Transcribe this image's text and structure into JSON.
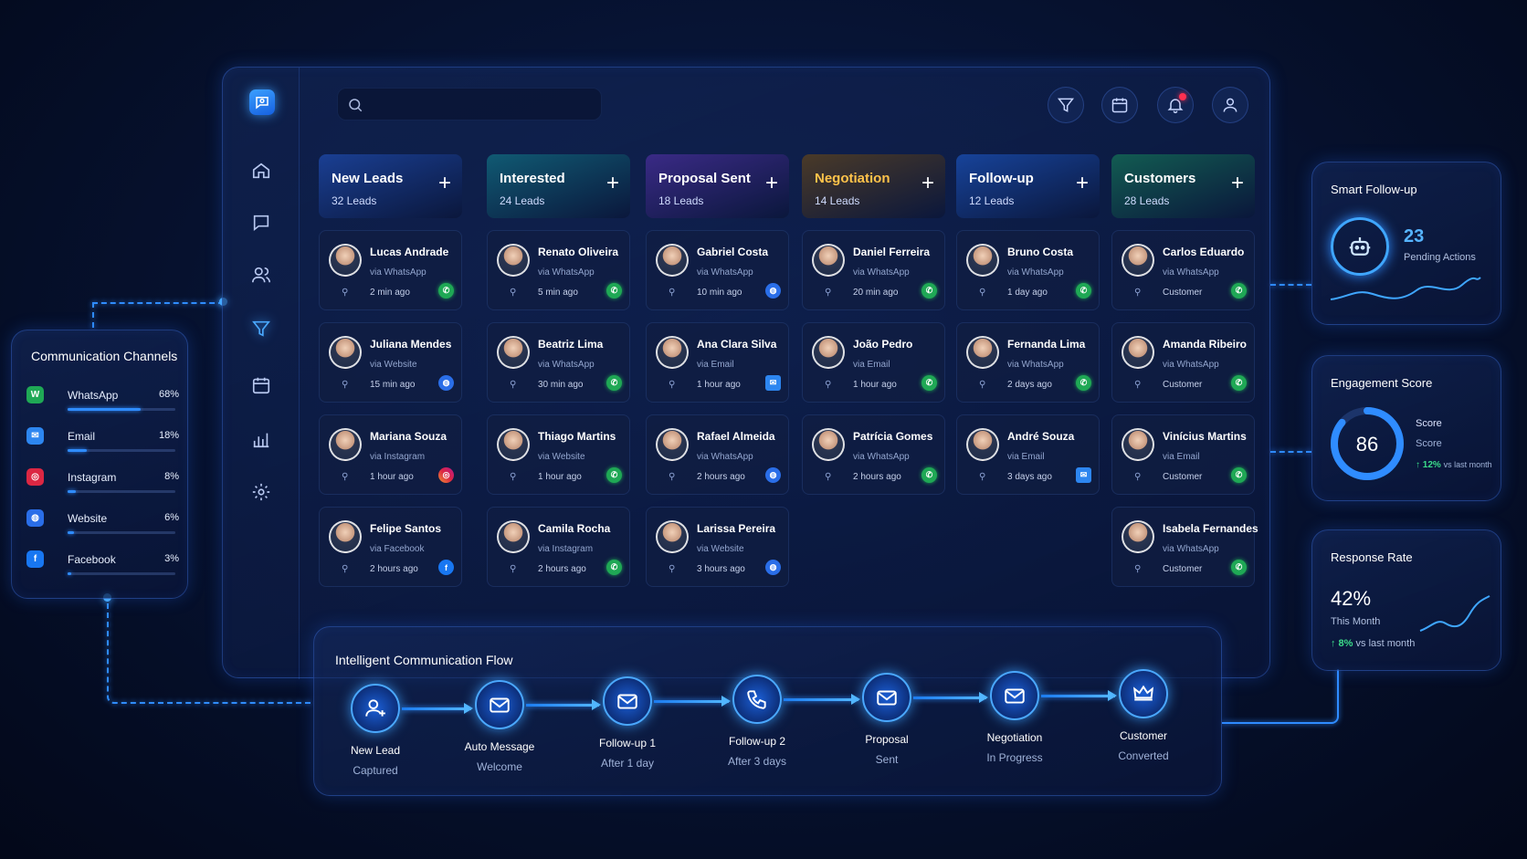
{
  "search": {
    "placeholder": ""
  },
  "columns": [
    {
      "title": "New Leads",
      "count": "32 Leads",
      "color": "#1a3f93",
      "cards": [
        {
          "name": "Lucas Andrade",
          "via": "via WhatsApp",
          "time": "2 min ago",
          "channel": "wa"
        },
        {
          "name": "Juliana Mendes",
          "via": "via Website",
          "time": "15 min ago",
          "channel": "web"
        },
        {
          "name": "Mariana Souza",
          "via": "via Instagram",
          "time": "1 hour ago",
          "channel": "ig"
        },
        {
          "name": "Felipe Santos",
          "via": "via Facebook",
          "time": "2 hours ago",
          "channel": "fb"
        }
      ]
    },
    {
      "title": "Interested",
      "count": "24 Leads",
      "color": "#105a73",
      "cards": [
        {
          "name": "Renato Oliveira",
          "via": "via WhatsApp",
          "time": "5 min ago",
          "channel": "wa"
        },
        {
          "name": "Beatriz Lima",
          "via": "via WhatsApp",
          "time": "30 min ago",
          "channel": "wa"
        },
        {
          "name": "Thiago Martins",
          "via": "via Website",
          "time": "1 hour ago",
          "channel": "wa"
        },
        {
          "name": "Camila Rocha",
          "via": "via Instagram",
          "time": "2 hours ago",
          "channel": "wa"
        }
      ]
    },
    {
      "title": "Proposal Sent",
      "count": "18 Leads",
      "color": "#3a2a86",
      "cards": [
        {
          "name": "Gabriel Costa",
          "via": "via WhatsApp",
          "time": "10 min ago",
          "channel": "web"
        },
        {
          "name": "Ana Clara Silva",
          "via": "via Email",
          "time": "1 hour ago",
          "channel": "em"
        },
        {
          "name": "Rafael Almeida",
          "via": "via WhatsApp",
          "time": "2 hours ago",
          "channel": "web"
        },
        {
          "name": "Larissa Pereira",
          "via": "via Website",
          "time": "3 hours ago",
          "channel": "web"
        }
      ]
    },
    {
      "title": "Negotiation",
      "count": "14 Leads",
      "color": "#4a3a28",
      "titleColor": "#ffc34a",
      "cards": [
        {
          "name": "Daniel Ferreira",
          "via": "via WhatsApp",
          "time": "20 min ago",
          "channel": "wa"
        },
        {
          "name": "João Pedro",
          "via": "via Email",
          "time": "1 hour ago",
          "channel": "wa"
        },
        {
          "name": "Patrícia Gomes",
          "via": "via WhatsApp",
          "time": "2 hours ago",
          "channel": "wa"
        }
      ]
    },
    {
      "title": "Follow-up",
      "count": "12 Leads",
      "color": "#17439a",
      "cards": [
        {
          "name": "Bruno Costa",
          "via": "via WhatsApp",
          "time": "1 day ago",
          "channel": "wa"
        },
        {
          "name": "Fernanda Lima",
          "via": "via WhatsApp",
          "time": "2 days ago",
          "channel": "wa"
        },
        {
          "name": "André Souza",
          "via": "via Email",
          "time": "3 days ago",
          "channel": "em"
        }
      ]
    },
    {
      "title": "Customers",
      "count": "28 Leads",
      "color": "#125c52",
      "cards": [
        {
          "name": "Carlos Eduardo",
          "via": "via WhatsApp",
          "time": "Customer",
          "channel": "wa"
        },
        {
          "name": "Amanda Ribeiro",
          "via": "via WhatsApp",
          "time": "Customer",
          "channel": "wa"
        },
        {
          "name": "Vinícius Martins",
          "via": "via Email",
          "time": "Customer",
          "channel": "wa"
        },
        {
          "name": "Isabela Fernandes",
          "via": "via WhatsApp",
          "time": "Customer",
          "channel": "wa"
        }
      ]
    }
  ],
  "channels": {
    "title": "Communication Channels",
    "items": [
      {
        "label": "WhatsApp",
        "pct": "68%",
        "value": 0.68,
        "icon": "whatsapp-icon",
        "color": "#1fa855",
        "glyph": "W"
      },
      {
        "label": "Email",
        "pct": "18%",
        "value": 0.18,
        "icon": "email-icon",
        "color": "#2d86f0",
        "glyph": "✉"
      },
      {
        "label": "Instagram",
        "pct": "8%",
        "value": 0.08,
        "icon": "instagram-icon",
        "color": "#dc2743",
        "glyph": "◎"
      },
      {
        "label": "Website",
        "pct": "6%",
        "value": 0.06,
        "icon": "globe-icon",
        "color": "#2a6ee8",
        "glyph": "◍"
      },
      {
        "label": "Facebook",
        "pct": "3%",
        "value": 0.03,
        "icon": "facebook-icon",
        "color": "#1877f2",
        "glyph": "f"
      }
    ]
  },
  "flow": {
    "title": "Intelligent Communication Flow",
    "steps": [
      {
        "l1": "New Lead",
        "l2": "Captured",
        "icon": "add-user-icon"
      },
      {
        "l1": "Auto Message",
        "l2": "Welcome",
        "icon": "mail-icon"
      },
      {
        "l1": "Follow-up 1",
        "l2": "After 1 day",
        "icon": "mail-icon"
      },
      {
        "l1": "Follow-up 2",
        "l2": "After 3 days",
        "icon": "phone-icon"
      },
      {
        "l1": "Proposal",
        "l2": "Sent",
        "icon": "mail-icon"
      },
      {
        "l1": "Negotiation",
        "l2": "In Progress",
        "icon": "mail-icon"
      },
      {
        "l1": "Customer",
        "l2": "Converted",
        "icon": "crown-icon"
      }
    ]
  },
  "smart": {
    "title": "Smart Follow-up",
    "value": "23",
    "label": "Pending Actions"
  },
  "engagement": {
    "title": "Engagement Score",
    "value": "86",
    "level": 0.86,
    "label1": "Score",
    "label2": "Score",
    "delta": "↑ 12%",
    "delta_note": "vs last month"
  },
  "response": {
    "title": "Response Rate",
    "value": "42%",
    "label": "This Month",
    "delta": "↑ 8%",
    "delta_note": "vs last month"
  }
}
